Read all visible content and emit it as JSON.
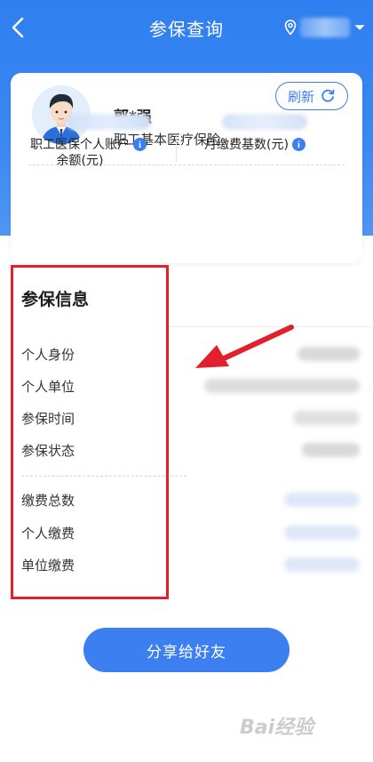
{
  "nav": {
    "title": "参保查询"
  },
  "profile": {
    "name": "郭*强",
    "insurance_type": "职工基本医疗保险",
    "refresh_label": "刷新"
  },
  "stats": {
    "balance_label_line1": "职工医保个人账户",
    "balance_label_line2": "余额(元)",
    "base_label": "月缴费基数(元)"
  },
  "info": {
    "title": "参保信息",
    "rows": [
      "个人身份",
      "个人单位",
      "参保时间",
      "参保状态"
    ],
    "payment_rows": [
      "缴费总数",
      "个人缴费",
      "单位缴费"
    ]
  },
  "share_label": "分享给好友",
  "watermark": "Bai经验",
  "colors": {
    "primary": "#3b7ff0",
    "annotation_red": "#e0202a"
  }
}
